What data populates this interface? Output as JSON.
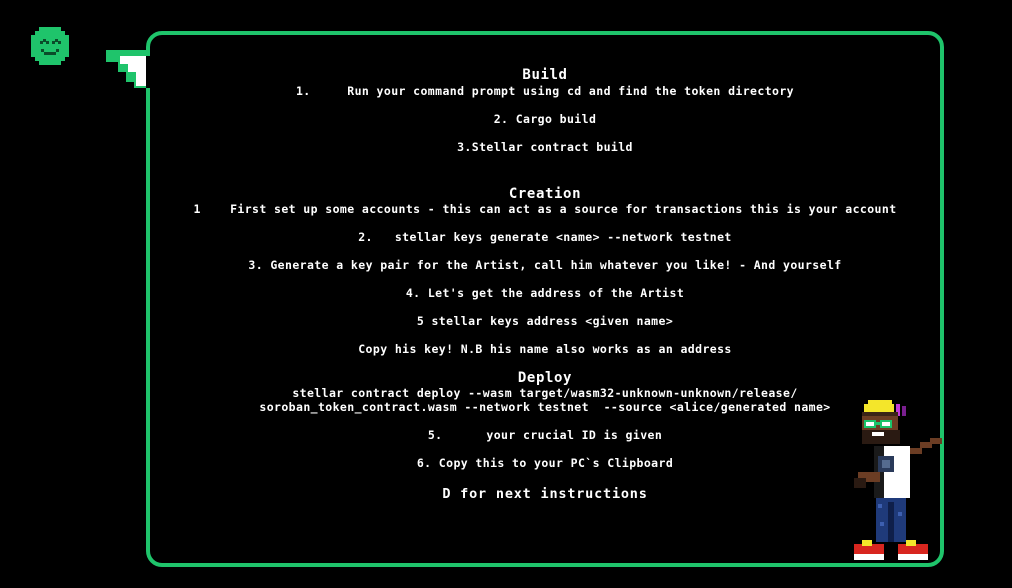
{
  "colors": {
    "accent": "#1fc46b",
    "background": "#000000",
    "text": "#ffffff"
  },
  "icons": {
    "corner": "smiley-face-icon",
    "character": "pixel-artist-character"
  },
  "build": {
    "heading": "Build",
    "steps": [
      "1.     Run your command prompt using cd and find the token directory",
      "2. Cargo build",
      "3.Stellar contract build"
    ]
  },
  "creation": {
    "heading": "Creation",
    "steps": [
      "1    First set up some accounts - this can act as a source for transactions this is your account",
      "2.   stellar keys generate <name> --network testnet",
      "3. Generate a key pair for the Artist, call him whatever you like! - And yourself",
      "4. Let's get the address of the Artist",
      "5 stellar keys address <given name>",
      "Copy his key! N.B his name also works as an address"
    ]
  },
  "deploy": {
    "heading": "Deploy",
    "command_line1": "stellar contract deploy --wasm target/wasm32-unknown-unknown/release/",
    "command_line2": "soroban_token_contract.wasm --network testnet  --source <alice/generated name>",
    "steps": [
      "5.      your crucial ID is given",
      "6. Copy this to your PC`s Clipboard"
    ]
  },
  "footer": {
    "next_label": "D for next instructions"
  }
}
